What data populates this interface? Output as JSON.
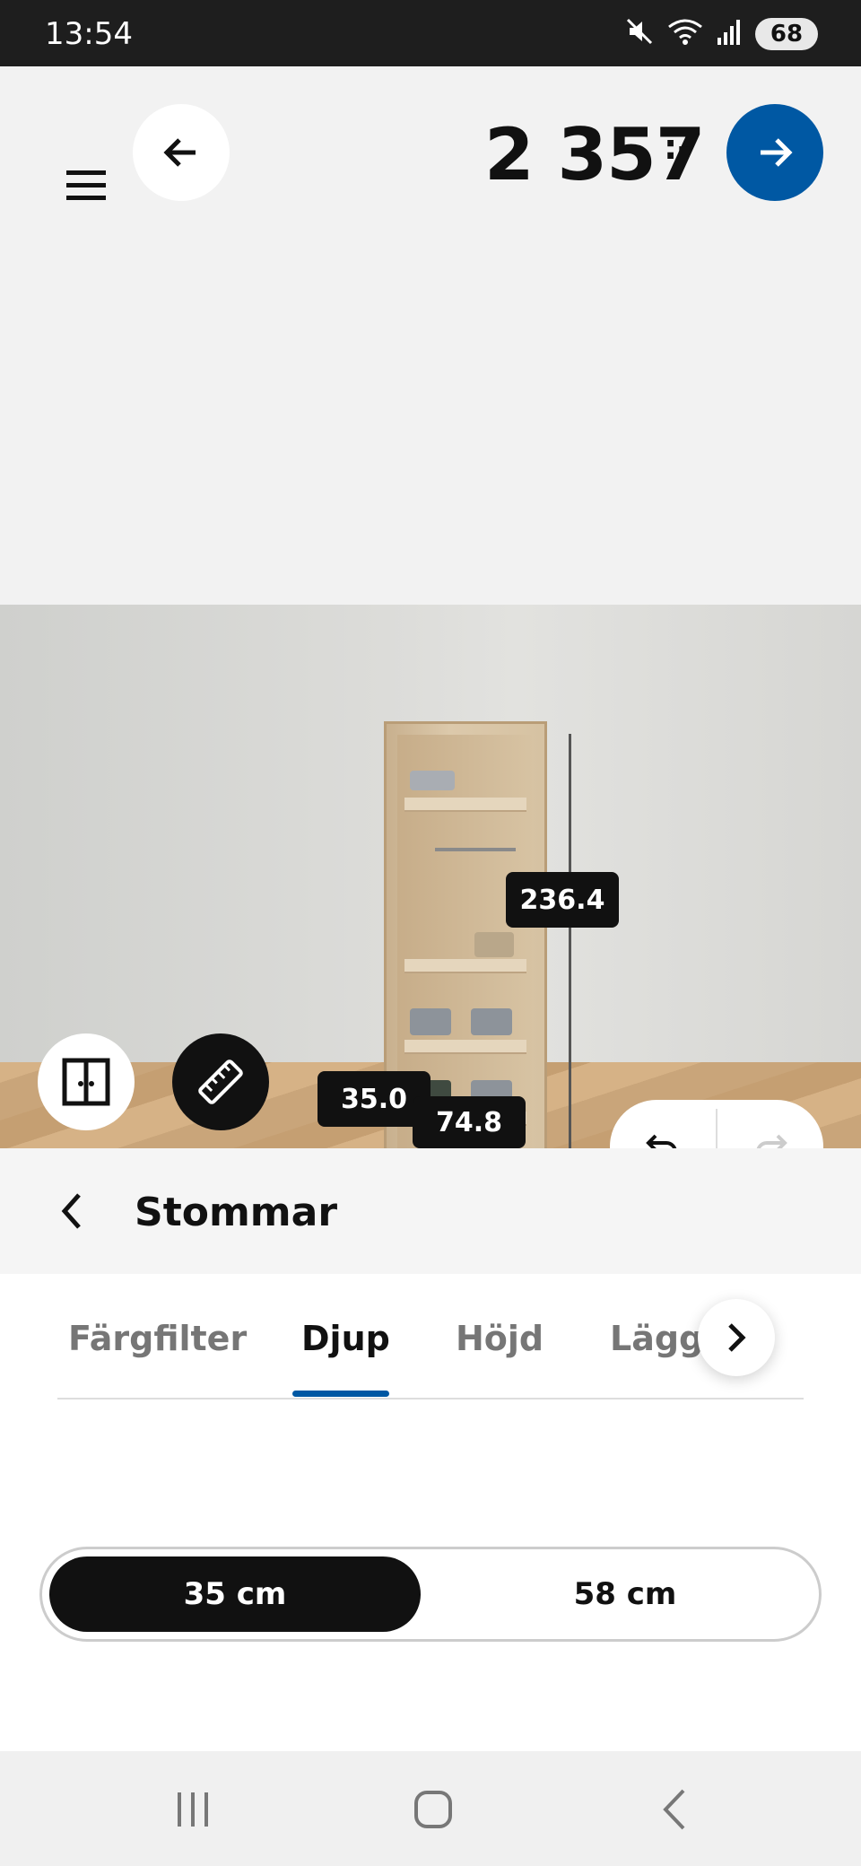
{
  "status_bar": {
    "time": "13:54",
    "battery": "68",
    "icons": [
      "mute-icon",
      "wifi-icon",
      "signal-icon",
      "battery-icon"
    ]
  },
  "header": {
    "price": "2 357",
    "price_suffix": ":-",
    "accent_color": "#0058a3"
  },
  "scene": {
    "dimension_height": "236.4",
    "dimension_depth": "35.0",
    "dimension_width": "74.8"
  },
  "section": {
    "title": "Stommar"
  },
  "tabs": [
    {
      "label": "Färgfilter",
      "active": false
    },
    {
      "label": "Djup",
      "active": true
    },
    {
      "label": "Höjd",
      "active": false
    },
    {
      "label": "Lägg till",
      "active": false
    }
  ],
  "depth_options": [
    {
      "label": "35 cm",
      "selected": true
    },
    {
      "label": "58 cm",
      "selected": false
    }
  ]
}
